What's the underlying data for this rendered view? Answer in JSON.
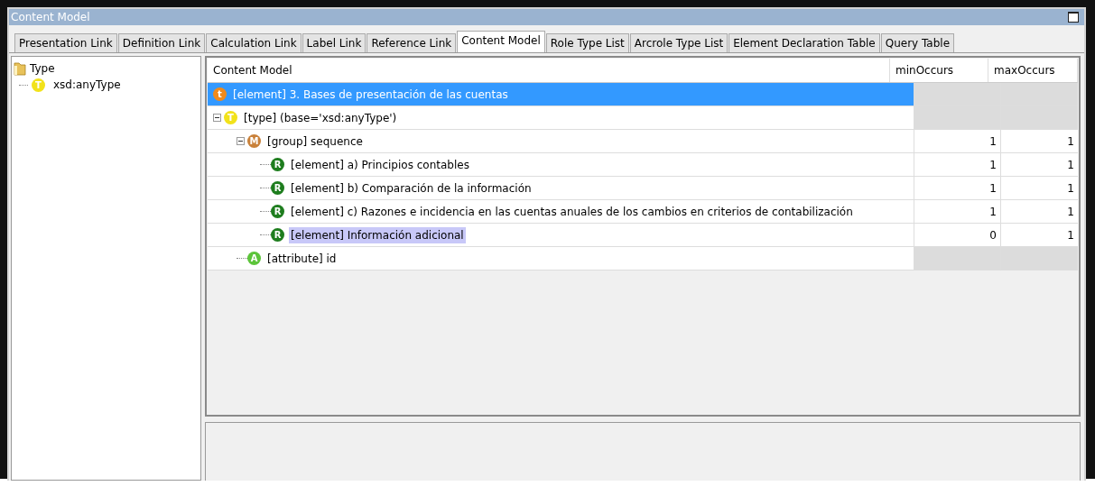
{
  "window": {
    "title": "Content Model"
  },
  "tabs": [
    {
      "label": "Presentation Link",
      "selected": false
    },
    {
      "label": "Definition Link",
      "selected": false
    },
    {
      "label": "Calculation Link",
      "selected": false
    },
    {
      "label": "Label Link",
      "selected": false
    },
    {
      "label": "Reference Link",
      "selected": false
    },
    {
      "label": "Content Model",
      "selected": true
    },
    {
      "label": "Role Type List",
      "selected": false
    },
    {
      "label": "Arcrole Type List",
      "selected": false
    },
    {
      "label": "Element Declaration Table",
      "selected": false
    },
    {
      "label": "Query Table",
      "selected": false
    }
  ],
  "type_tree": [
    {
      "label": "Type",
      "kind": "folder",
      "children": [
        {
          "label": "xsd:anyType",
          "kind": "type",
          "badge": "T"
        }
      ]
    }
  ],
  "table": {
    "columns": [
      "Content Model",
      "minOccurs",
      "maxOccurs"
    ],
    "rows": [
      {
        "kind": "element-root",
        "badge": "t",
        "label": "[element] 3. Bases de presentación de las cuentas",
        "selected": true,
        "highlighted": false
      },
      {
        "kind": "type",
        "badge": "T",
        "label": "[type]  (base='xsd:anyType')",
        "selected": false,
        "highlighted": false,
        "expanded": true,
        "children": [
          {
            "kind": "group",
            "badge": "M",
            "label": "[group] sequence",
            "min": "1",
            "max": "1",
            "selected": false,
            "highlighted": false,
            "expanded": true,
            "children": [
              {
                "kind": "element-ref",
                "badge": "R",
                "label": "[element] a) Principios contables",
                "min": "1",
                "max": "1",
                "selected": false,
                "highlighted": false
              },
              {
                "kind": "element-ref",
                "badge": "R",
                "label": "[element] b) Comparación de la información",
                "min": "1",
                "max": "1",
                "selected": false,
                "highlighted": false
              },
              {
                "kind": "element-ref",
                "badge": "R",
                "label": "[element] c) Razones e incidencia en las cuentas anuales de los cambios en criterios de contabilización",
                "min": "1",
                "max": "1",
                "selected": false,
                "highlighted": false
              },
              {
                "kind": "element-ref",
                "badge": "R",
                "label": "[element] Información adicional",
                "min": "0",
                "max": "1",
                "selected": false,
                "highlighted": true
              }
            ]
          },
          {
            "kind": "attribute",
            "badge": "A",
            "label": "[attribute] id",
            "selected": false,
            "highlighted": false
          }
        ]
      }
    ]
  }
}
